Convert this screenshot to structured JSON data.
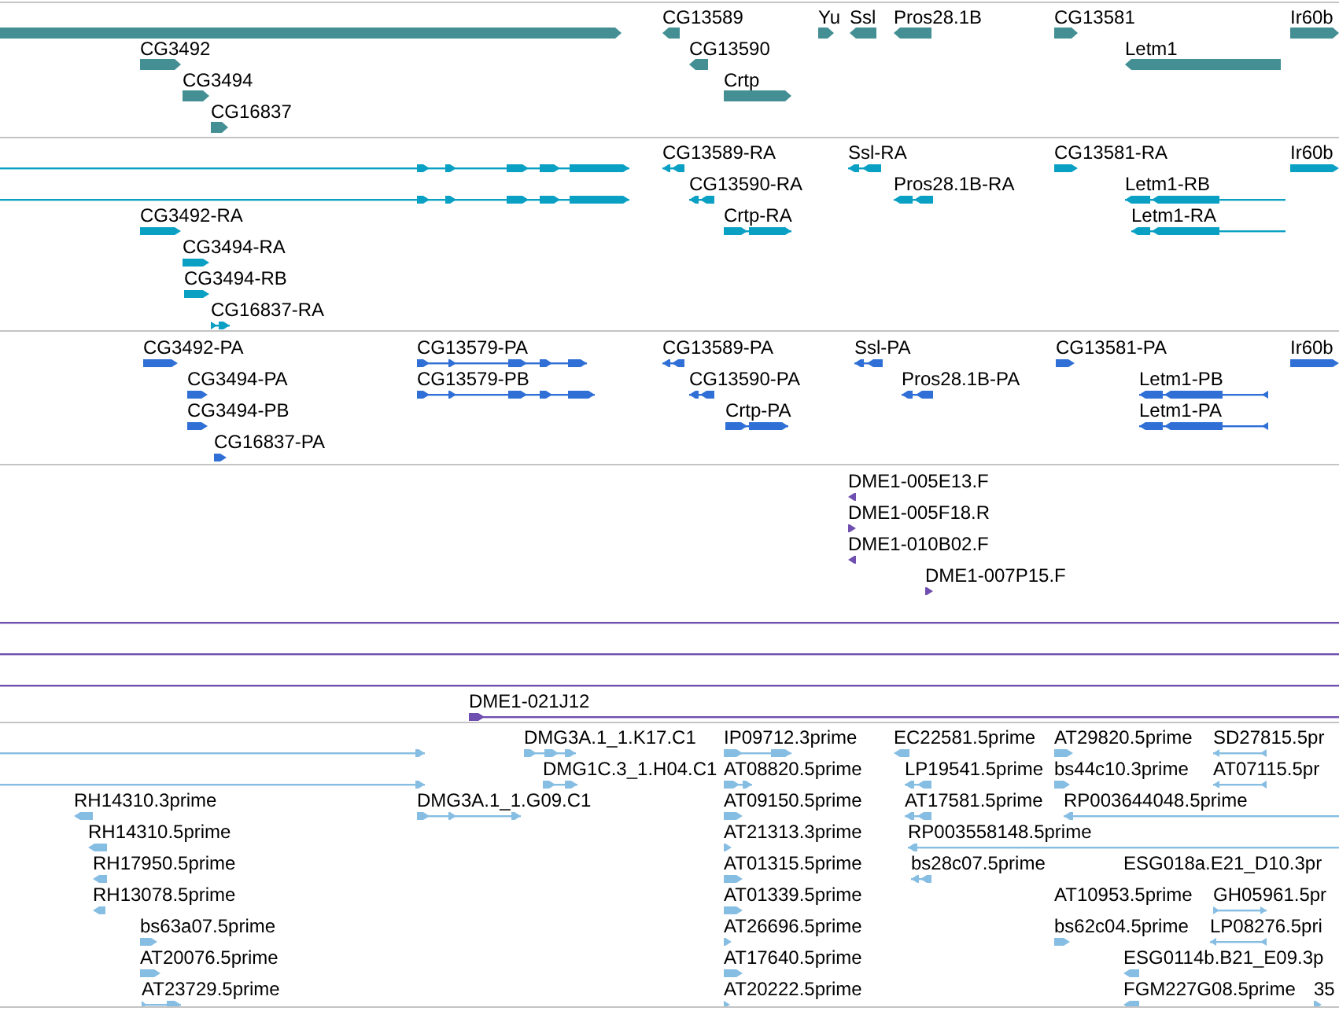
{
  "tracks": [
    {
      "kind": "genes",
      "rows": [
        {
          "features": [
            {
              "reverse": false,
              "kind": "block"
            },
            {
              "label": "CG13589",
              "reverse": true,
              "kind": "block"
            },
            {
              "label": "Yu",
              "reverse": false,
              "kind": "block"
            },
            {
              "label": "Ssl",
              "reverse": true,
              "kind": "block"
            },
            {
              "label": "Pros28.1B",
              "reverse": true,
              "kind": "block"
            },
            {
              "label": "CG13581",
              "reverse": false,
              "kind": "block"
            },
            {
              "label": "Ir60b",
              "reverse": false,
              "kind": "block"
            }
          ]
        },
        {
          "features": [
            {
              "label": "CG3492",
              "reverse": false,
              "kind": "block"
            },
            {
              "label": "CG13590",
              "reverse": true,
              "kind": "block"
            },
            {
              "label": "Letm1",
              "reverse": true,
              "kind": "block"
            }
          ]
        },
        {
          "features": [
            {
              "label": "CG3494",
              "reverse": false,
              "kind": "block"
            },
            {
              "label": "Crtp",
              "reverse": false,
              "kind": "block"
            }
          ]
        },
        {
          "features": [
            {
              "label": "CG16837",
              "reverse": false,
              "kind": "block"
            }
          ]
        }
      ]
    },
    {
      "kind": "transcripts",
      "rows": [
        {
          "features": [
            {
              "reverse": false,
              "kind": "spliced"
            },
            {
              "label": "CG13589-RA",
              "reverse": true,
              "kind": "spliced"
            },
            {
              "label": "Ssl-RA",
              "reverse": true,
              "kind": "spliced"
            },
            {
              "label": "CG13581-RA",
              "reverse": false,
              "kind": "block"
            },
            {
              "label": "Ir60b",
              "reverse": false,
              "kind": "block"
            }
          ]
        },
        {
          "features": [
            {
              "reverse": false,
              "kind": "spliced"
            },
            {
              "label": "CG13590-RA",
              "reverse": true,
              "kind": "spliced"
            },
            {
              "label": "Pros28.1B-RA",
              "reverse": true,
              "kind": "spliced"
            },
            {
              "label": "Letm1-RB",
              "reverse": true,
              "kind": "spliced"
            }
          ]
        },
        {
          "features": [
            {
              "label": "CG3492-RA",
              "reverse": false,
              "kind": "block"
            },
            {
              "label": "Crtp-RA",
              "reverse": false,
              "kind": "spliced"
            },
            {
              "label": "Letm1-RA",
              "reverse": true,
              "kind": "spliced"
            }
          ]
        },
        {
          "features": [
            {
              "label": "CG3494-RA",
              "reverse": false,
              "kind": "block"
            }
          ]
        },
        {
          "features": [
            {
              "label": "CG3494-RB",
              "reverse": false,
              "kind": "block"
            }
          ]
        },
        {
          "features": [
            {
              "label": "CG16837-RA",
              "reverse": false,
              "kind": "spliced"
            }
          ]
        }
      ]
    },
    {
      "kind": "proteins",
      "rows": [
        {
          "features": [
            {
              "label": "CG3492-PA",
              "reverse": false,
              "kind": "block"
            },
            {
              "label": "CG13579-PA",
              "reverse": false,
              "kind": "spliced"
            },
            {
              "label": "CG13589-PA",
              "reverse": true,
              "kind": "spliced"
            },
            {
              "label": "Ssl-PA",
              "reverse": true,
              "kind": "spliced"
            },
            {
              "label": "CG13581-PA",
              "reverse": false,
              "kind": "block"
            },
            {
              "label": "Ir60b",
              "reverse": false,
              "kind": "block"
            }
          ]
        },
        {
          "features": [
            {
              "label": "CG3494-PA",
              "reverse": false,
              "kind": "block"
            },
            {
              "label": "CG13579-PB",
              "reverse": false,
              "kind": "spliced"
            },
            {
              "label": "CG13590-PA",
              "reverse": true,
              "kind": "spliced"
            },
            {
              "label": "Pros28.1B-PA",
              "reverse": true,
              "kind": "spliced"
            },
            {
              "label": "Letm1-PB",
              "reverse": true,
              "kind": "spliced"
            }
          ]
        },
        {
          "features": [
            {
              "label": "CG3494-PB",
              "reverse": false,
              "kind": "block"
            },
            {
              "label": "Crtp-PA",
              "reverse": false,
              "kind": "spliced"
            },
            {
              "label": "Letm1-PA",
              "reverse": true,
              "kind": "spliced"
            }
          ]
        },
        {
          "features": [
            {
              "label": "CG16837-PA",
              "reverse": false,
              "kind": "block"
            }
          ]
        }
      ]
    },
    {
      "kind": "bac_ends",
      "rows": [
        {
          "features": [
            {
              "label": "DME1-005E13.F",
              "reverse": true,
              "kind": "block"
            }
          ]
        },
        {
          "features": [
            {
              "label": "DME1-005F18.R",
              "reverse": false,
              "kind": "block"
            }
          ]
        },
        {
          "features": [
            {
              "label": "DME1-010B02.F",
              "reverse": true,
              "kind": "block"
            }
          ]
        },
        {
          "features": [
            {
              "label": "DME1-007P15.F",
              "reverse": false,
              "kind": "block"
            }
          ]
        },
        {
          "features": [
            {
              "kind": "line"
            }
          ]
        },
        {
          "features": [
            {
              "kind": "line"
            }
          ]
        },
        {
          "features": [
            {
              "kind": "line"
            }
          ]
        },
        {
          "features": [
            {
              "label": "DME1-021J12",
              "reverse": false,
              "kind": "spliced"
            }
          ]
        }
      ]
    },
    {
      "kind": "ests",
      "rows": [
        {
          "features": [
            {
              "reverse": false,
              "kind": "line"
            },
            {
              "label": "DMG3A.1_1.K17.C1",
              "reverse": false,
              "kind": "spliced"
            },
            {
              "label": "IP09712.3prime",
              "reverse": false,
              "kind": "spliced"
            },
            {
              "label": "EC22581.5prime",
              "reverse": true,
              "kind": "block"
            },
            {
              "label": "AT29820.5prime",
              "reverse": false,
              "kind": "block"
            },
            {
              "label": "SD27815.5pr",
              "reverse": true,
              "kind": "spliced"
            }
          ]
        },
        {
          "features": [
            {
              "reverse": false,
              "kind": "line"
            },
            {
              "label": "DMG1C.3_1.H04.C1",
              "reverse": false,
              "kind": "spliced"
            },
            {
              "label": "AT08820.5prime",
              "reverse": false,
              "kind": "spliced"
            },
            {
              "label": "LP19541.5prime",
              "reverse": true,
              "kind": "spliced"
            },
            {
              "label": "bs44c10.3prime",
              "reverse": false,
              "kind": "block"
            },
            {
              "label": "AT07115.5pr",
              "reverse": true,
              "kind": "spliced"
            }
          ]
        },
        {
          "features": [
            {
              "label": "RH14310.3prime",
              "reverse": true,
              "kind": "block"
            },
            {
              "label": "DMG3A.1_1.G09.C1",
              "reverse": false,
              "kind": "spliced"
            },
            {
              "label": "AT09150.5prime",
              "reverse": false,
              "kind": "block"
            },
            {
              "label": "AT17581.5prime",
              "reverse": true,
              "kind": "spliced"
            },
            {
              "label": "RP003644048.5prime",
              "reverse": true,
              "kind": "line"
            }
          ]
        },
        {
          "features": [
            {
              "label": "RH14310.5prime",
              "reverse": true,
              "kind": "block"
            },
            {
              "label": "AT21313.3prime",
              "reverse": false,
              "kind": "block"
            },
            {
              "label": "RP003558148.5prime",
              "reverse": true,
              "kind": "line"
            }
          ]
        },
        {
          "features": [
            {
              "label": "RH17950.5prime",
              "reverse": true,
              "kind": "block"
            },
            {
              "label": "AT01315.5prime",
              "reverse": false,
              "kind": "block"
            },
            {
              "label": "bs28c07.5prime",
              "reverse": true,
              "kind": "spliced"
            },
            {
              "label": "ESG018a.E21_D10.3pr"
            }
          ]
        },
        {
          "features": [
            {
              "label": "RH13078.5prime",
              "reverse": true,
              "kind": "block"
            },
            {
              "label": "AT01339.5prime",
              "reverse": false,
              "kind": "block"
            },
            {
              "label": "AT10953.5prime"
            },
            {
              "label": "GH05961.5pr",
              "reverse": false,
              "kind": "spliced"
            }
          ]
        },
        {
          "features": [
            {
              "label": "bs63a07.5prime",
              "reverse": false,
              "kind": "block"
            },
            {
              "label": "AT26696.5prime",
              "reverse": false,
              "kind": "block"
            },
            {
              "label": "bs62c04.5prime",
              "reverse": false,
              "kind": "block"
            },
            {
              "label": "LP08276.5pri",
              "reverse": true,
              "kind": "spliced"
            }
          ]
        },
        {
          "features": [
            {
              "label": "AT20076.5prime",
              "reverse": false,
              "kind": "block"
            },
            {
              "label": "AT17640.5prime",
              "reverse": false,
              "kind": "block"
            },
            {
              "label": "ESG0114b.B21_E09.3p",
              "reverse": true,
              "kind": "block"
            }
          ]
        },
        {
          "features": [
            {
              "label": "AT23729.5prime",
              "reverse": false,
              "kind": "spliced"
            },
            {
              "label": "AT20222.5prime",
              "reverse": false,
              "kind": "block"
            },
            {
              "label": "FGM227G08.5prime",
              "reverse": true,
              "kind": "block"
            },
            {
              "label": "35",
              "reverse": false,
              "kind": "block"
            }
          ]
        }
      ]
    }
  ]
}
